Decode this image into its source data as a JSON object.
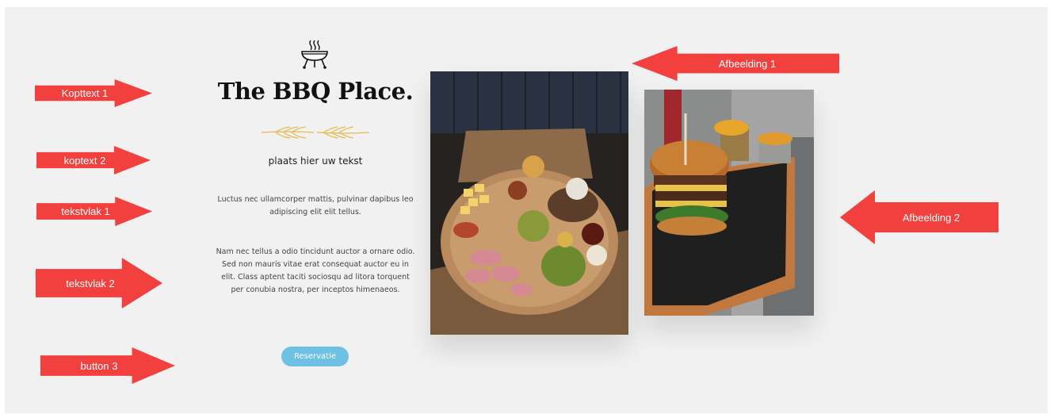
{
  "content": {
    "title": "The BBQ Place.",
    "subtitle": "plaats hier uw tekst",
    "paragraph1": "Luctus nec ullamcorper mattis, pulvinar dapibus leo adipiscing elit elit tellus.",
    "paragraph2": "Nam nec tellus a odio tincidunt auctor a ornare odio. Sed non mauris vitae erat consequat auctor eu in elit. Class aptent taciti sociosqu ad litora torquent per conubia nostra, per inceptos himenaeos.",
    "button_label": "Reservatie",
    "icon": "grill-icon"
  },
  "annotations": {
    "kopttext1": "Kopttext 1",
    "koptext2": "koptext 2",
    "tekstvlak1": "tekstvlak 1",
    "tekstvlak2": "tekstvlak 2",
    "button3": "button 3",
    "afbeelding1": "Afbeelding 1",
    "afbeelding2": "Afbeelding 2"
  },
  "colors": {
    "panel_bg": "#f1f1f1",
    "arrow": "#f2403e",
    "button": "#6ec1e4",
    "divider": "#e8b84a"
  }
}
